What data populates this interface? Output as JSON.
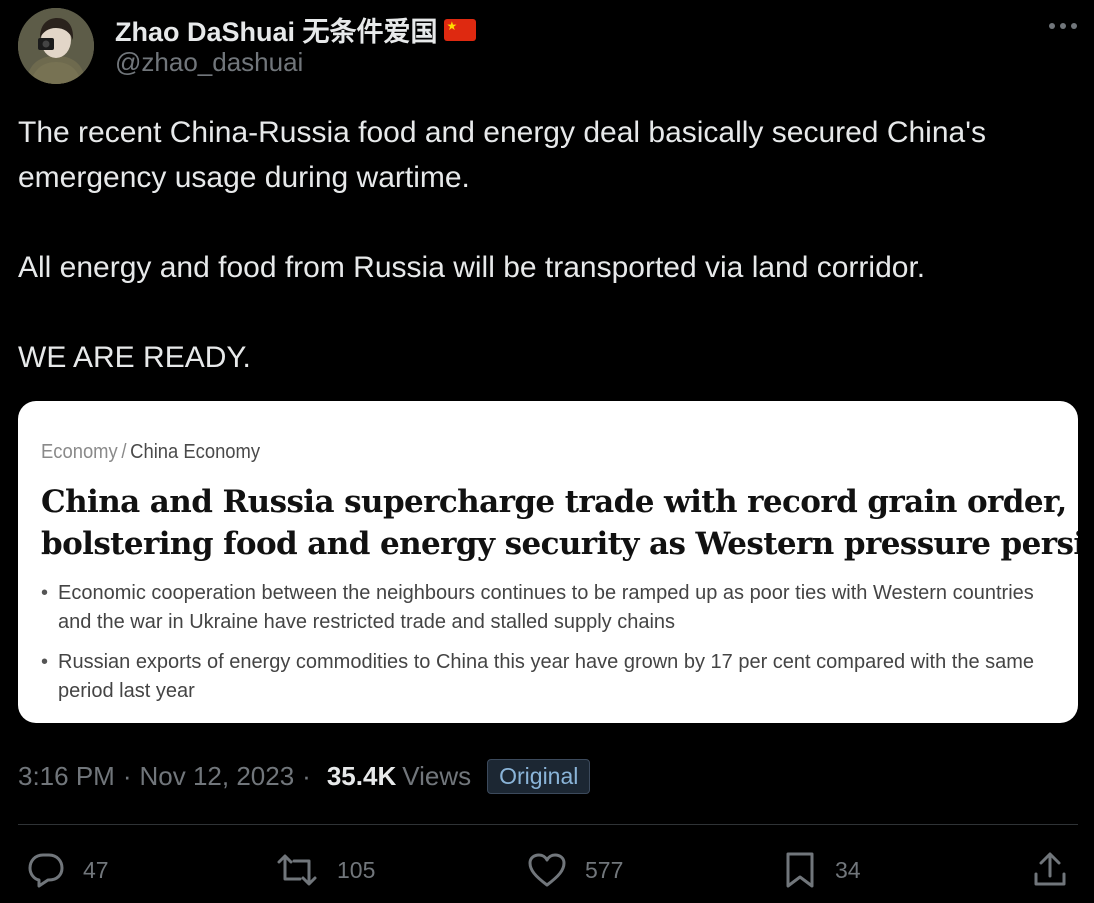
{
  "author": {
    "display_name": "Zhao DaShuai 无条件爱国",
    "handle": "@zhao_dashuai"
  },
  "tweet": {
    "paragraphs": [
      "The recent China-Russia food and energy deal basically secured China's",
      "emergency usage during wartime.",
      "All energy and food from Russia will be transported via land corridor.",
      "WE ARE READY."
    ]
  },
  "card": {
    "breadcrumb_section": "Economy",
    "breadcrumb_separator": "/",
    "breadcrumb_subsection": "China Economy",
    "headline_line1": "China and Russia supercharge trade with record grain order,",
    "headline_line2": "bolstering food and energy security as Western pressure persists",
    "bullets": [
      "Economic cooperation between the neighbours continues to be ramped up as poor ties with Western countries and the war in Ukraine have restricted trade and stalled supply chains",
      "Russian exports of energy commodities to China this year have grown by 17 per cent compared with the same period last year"
    ]
  },
  "meta": {
    "time": "3:16 PM",
    "separator": "·",
    "date": "Nov 12, 2023",
    "views_count": "35.4K",
    "views_label": "Views",
    "badge": "Original"
  },
  "actions": {
    "replies": "47",
    "retweets": "105",
    "likes": "577",
    "bookmarks": "34"
  },
  "icons": {
    "more": "more-horizontal-icon",
    "reply": "reply-icon",
    "retweet": "retweet-icon",
    "like": "heart-icon",
    "bookmark": "bookmark-icon",
    "share": "share-icon",
    "flag": "china-flag-icon"
  },
  "colors": {
    "background": "#000000",
    "text_primary": "#e7e9ea",
    "text_secondary": "#71767b",
    "badge_text": "#8ab4d8",
    "card_background": "#ffffff"
  }
}
